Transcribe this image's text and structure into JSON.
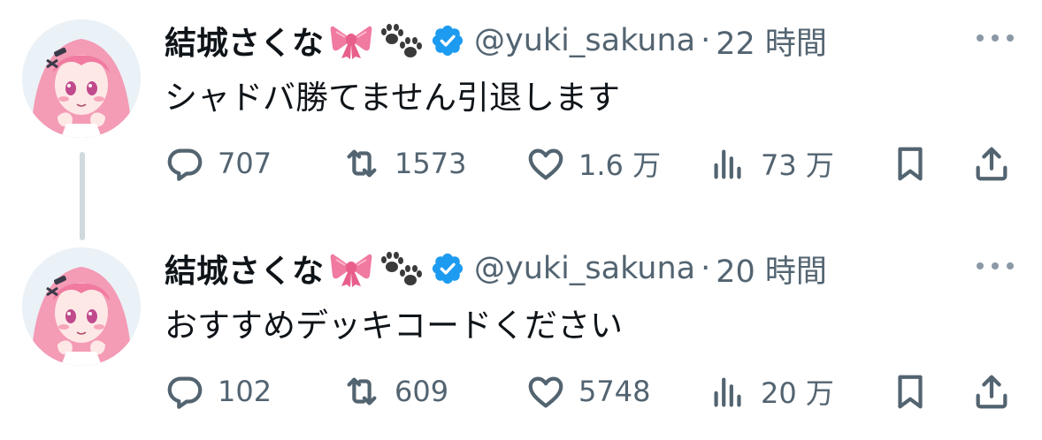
{
  "tweets": [
    {
      "display_name": "結城さくな",
      "emojis": [
        "ribbon-icon",
        "paw-prints-icon"
      ],
      "handle": "@yuki_sakuna",
      "separator": "·",
      "time": "22 時間",
      "text": "シャドバ勝てません引退します",
      "replies": "707",
      "retweets": "1573",
      "likes": "1.6 万",
      "views": "73 万"
    },
    {
      "display_name": "結城さくな",
      "emojis": [
        "ribbon-icon",
        "paw-prints-icon"
      ],
      "handle": "@yuki_sakuna",
      "separator": "·",
      "time": "20 時間",
      "text": "おすすめデッキコードください",
      "replies": "102",
      "retweets": "609",
      "likes": "5748",
      "views": "20 万"
    }
  ],
  "colors": {
    "text_primary": "#0f1419",
    "text_secondary": "#536471",
    "verified_blue": "#1d9bf0",
    "thread_line": "#cfd9de",
    "ribbon_pink": "#f07aa0"
  }
}
